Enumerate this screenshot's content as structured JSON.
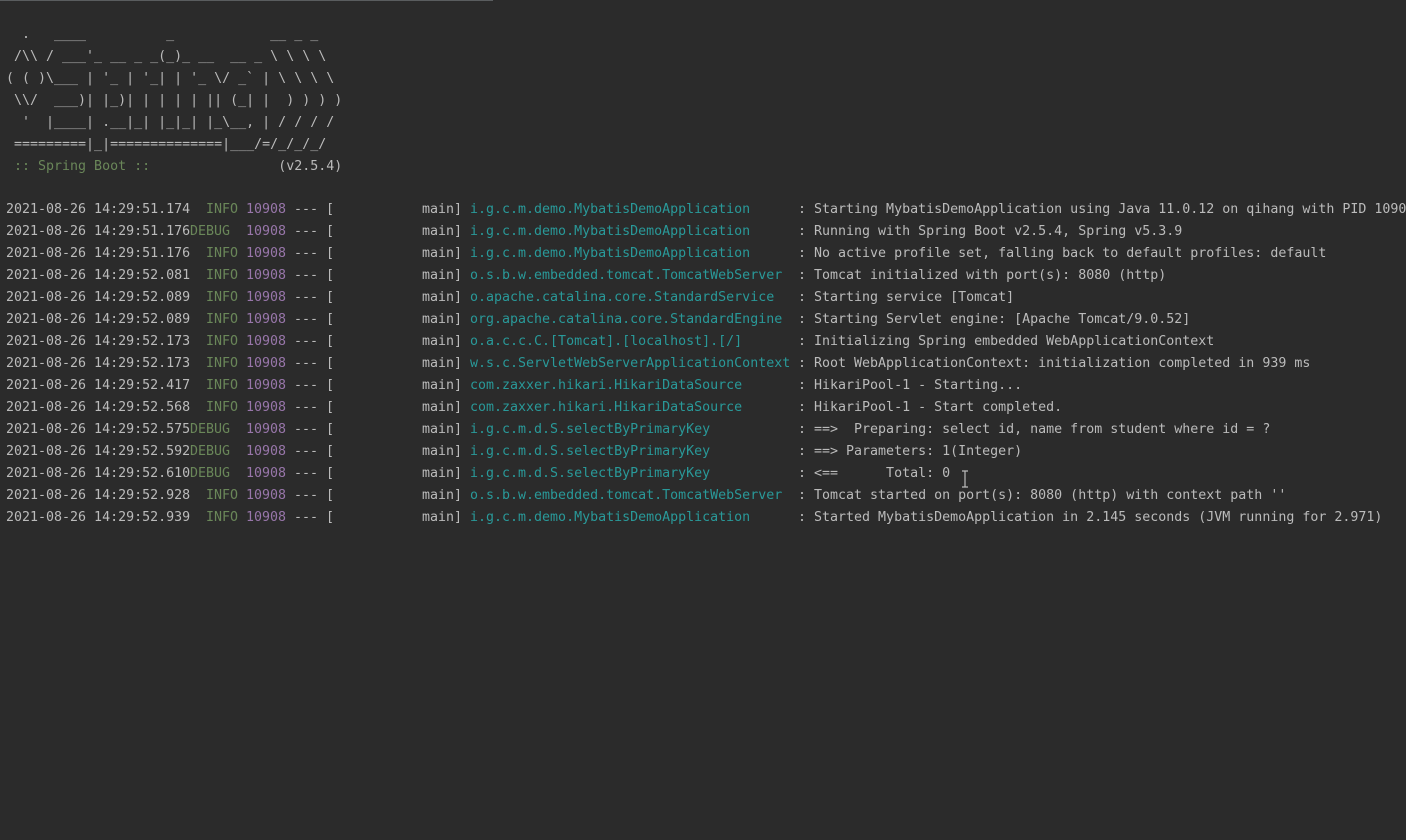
{
  "banner": {
    "lines": [
      "  .   ____          _            __ _ _",
      " /\\\\ / ___'_ __ _ _(_)_ __  __ _ \\ \\ \\ \\",
      "( ( )\\___ | '_ | '_| | '_ \\/ _` | \\ \\ \\ \\",
      " \\\\/  ___)| |_)| | | | | || (_| |  ) ) ) )",
      "  '  |____| .__|_| |_|_| |_\\__, | / / / /",
      " =========|_|==============|___/=/_/_/_/"
    ],
    "spring_label": " :: Spring Boot :: ",
    "spring_version": "               (v2.5.4)"
  },
  "log": {
    "rows": [
      {
        "timestamp": "2021-08-26 14:29:51.174",
        "level": "INFO",
        "pid": "10908",
        "separator": "--- [",
        "thread": "main]",
        "logger": "i.g.c.m.demo.MybatisDemoApplication",
        "message": ": Starting MybatisDemoApplication using Java 11.0.12 on qihang with PID 1090"
      },
      {
        "timestamp": "2021-08-26 14:29:51.176",
        "level": "DEBUG",
        "pid": "10908",
        "separator": "--- [",
        "thread": "main]",
        "logger": "i.g.c.m.demo.MybatisDemoApplication",
        "message": ": Running with Spring Boot v2.5.4, Spring v5.3.9"
      },
      {
        "timestamp": "2021-08-26 14:29:51.176",
        "level": "INFO",
        "pid": "10908",
        "separator": "--- [",
        "thread": "main]",
        "logger": "i.g.c.m.demo.MybatisDemoApplication",
        "message": ": No active profile set, falling back to default profiles: default"
      },
      {
        "timestamp": "2021-08-26 14:29:52.081",
        "level": "INFO",
        "pid": "10908",
        "separator": "--- [",
        "thread": "main]",
        "logger": "o.s.b.w.embedded.tomcat.TomcatWebServer",
        "message": ": Tomcat initialized with port(s): 8080 (http)"
      },
      {
        "timestamp": "2021-08-26 14:29:52.089",
        "level": "INFO",
        "pid": "10908",
        "separator": "--- [",
        "thread": "main]",
        "logger": "o.apache.catalina.core.StandardService",
        "message": ": Starting service [Tomcat]"
      },
      {
        "timestamp": "2021-08-26 14:29:52.089",
        "level": "INFO",
        "pid": "10908",
        "separator": "--- [",
        "thread": "main]",
        "logger": "org.apache.catalina.core.StandardEngine",
        "message": ": Starting Servlet engine: [Apache Tomcat/9.0.52]"
      },
      {
        "timestamp": "2021-08-26 14:29:52.173",
        "level": "INFO",
        "pid": "10908",
        "separator": "--- [",
        "thread": "main]",
        "logger": "o.a.c.c.C.[Tomcat].[localhost].[/]",
        "message": ": Initializing Spring embedded WebApplicationContext"
      },
      {
        "timestamp": "2021-08-26 14:29:52.173",
        "level": "INFO",
        "pid": "10908",
        "separator": "--- [",
        "thread": "main]",
        "logger": "w.s.c.ServletWebServerApplicationContext",
        "message": ": Root WebApplicationContext: initialization completed in 939 ms"
      },
      {
        "timestamp": "2021-08-26 14:29:52.417",
        "level": "INFO",
        "pid": "10908",
        "separator": "--- [",
        "thread": "main]",
        "logger": "com.zaxxer.hikari.HikariDataSource",
        "message": ": HikariPool-1 - Starting..."
      },
      {
        "timestamp": "2021-08-26 14:29:52.568",
        "level": "INFO",
        "pid": "10908",
        "separator": "--- [",
        "thread": "main]",
        "logger": "com.zaxxer.hikari.HikariDataSource",
        "message": ": HikariPool-1 - Start completed."
      },
      {
        "timestamp": "2021-08-26 14:29:52.575",
        "level": "DEBUG",
        "pid": "10908",
        "separator": "--- [",
        "thread": "main]",
        "logger": "i.g.c.m.d.S.selectByPrimaryKey",
        "message": ": ==>  Preparing: select id, name from student where id = ?"
      },
      {
        "timestamp": "2021-08-26 14:29:52.592",
        "level": "DEBUG",
        "pid": "10908",
        "separator": "--- [",
        "thread": "main]",
        "logger": "i.g.c.m.d.S.selectByPrimaryKey",
        "message": ": ==> Parameters: 1(Integer)"
      },
      {
        "timestamp": "2021-08-26 14:29:52.610",
        "level": "DEBUG",
        "pid": "10908",
        "separator": "--- [",
        "thread": "main]",
        "logger": "i.g.c.m.d.S.selectByPrimaryKey",
        "message": ": <==      Total: 0"
      },
      {
        "timestamp": "2021-08-26 14:29:52.928",
        "level": "INFO",
        "pid": "10908",
        "separator": "--- [",
        "thread": "main]",
        "logger": "o.s.b.w.embedded.tomcat.TomcatWebServer",
        "message": ": Tomcat started on port(s): 8080 (http) with context path ''"
      },
      {
        "timestamp": "2021-08-26 14:29:52.939",
        "level": "INFO",
        "pid": "10908",
        "separator": "--- [",
        "thread": "main]",
        "logger": "i.g.c.m.demo.MybatisDemoApplication",
        "message": ": Started MybatisDemoApplication in 2.145 seconds (JVM running for 2.971)"
      }
    ]
  },
  "colors": {
    "background": "#2b2b2b",
    "text": "#bbbbbb",
    "level": "#6a8759",
    "pid": "#9876aa",
    "logger": "#299999",
    "spring_label": "#6a8759"
  },
  "cursor": {
    "icon": "text-cursor-icon"
  }
}
